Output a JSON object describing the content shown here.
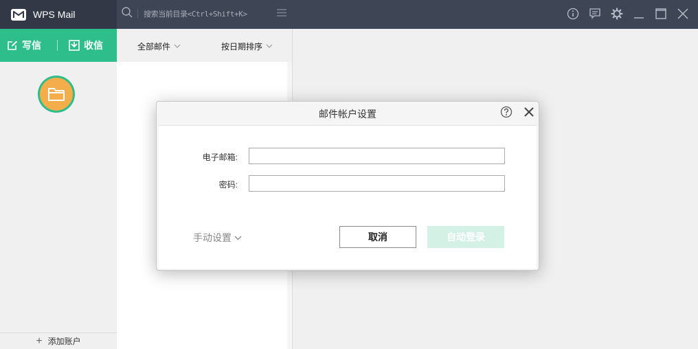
{
  "app": {
    "name": "WPS Mail"
  },
  "search": {
    "placeholder": "搜索当前目录<Ctrl+Shift+K>"
  },
  "sidebar": {
    "compose_label": "写信",
    "receive_label": "收信",
    "add_account_label": "添加账户"
  },
  "mail_list": {
    "filter_label": "全部邮件",
    "sort_label": "按日期排序"
  },
  "dialog": {
    "title": "邮件帐户设置",
    "email_label": "电子邮箱:",
    "email_value": "",
    "password_label": "密码:",
    "password_value": "",
    "manual_label": "手动设置",
    "cancel_label": "取消",
    "login_label": "自动登录"
  },
  "colors": {
    "accent": "#2dbe8c",
    "titlebar": "#3e4554",
    "brand_bg": "#323845",
    "folder": "#f4ad4b",
    "login_disabled": "#d4f1e6"
  },
  "icons": [
    "mail-logo-icon",
    "search-icon",
    "menu-icon",
    "info-icon",
    "feedback-icon",
    "settings-gear-icon",
    "minimize-icon",
    "maximize-icon",
    "close-icon",
    "compose-icon",
    "receive-icon",
    "folder-icon",
    "plus-icon",
    "chevron-down-icon",
    "help-icon"
  ]
}
